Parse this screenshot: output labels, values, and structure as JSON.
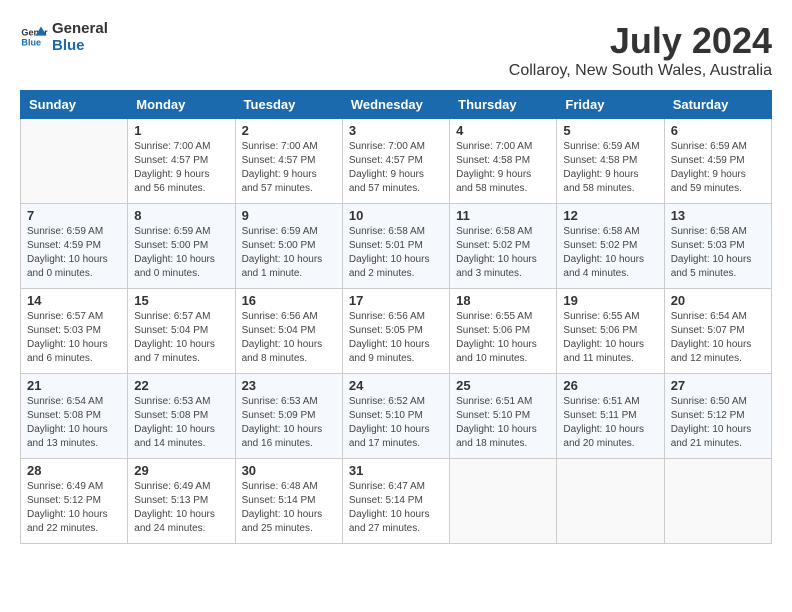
{
  "logo": {
    "line1": "General",
    "line2": "Blue"
  },
  "title": "July 2024",
  "subtitle": "Collaroy, New South Wales, Australia",
  "days_of_week": [
    "Sunday",
    "Monday",
    "Tuesday",
    "Wednesday",
    "Thursday",
    "Friday",
    "Saturday"
  ],
  "weeks": [
    [
      {
        "num": "",
        "info": ""
      },
      {
        "num": "1",
        "info": "Sunrise: 7:00 AM\nSunset: 4:57 PM\nDaylight: 9 hours\nand 56 minutes."
      },
      {
        "num": "2",
        "info": "Sunrise: 7:00 AM\nSunset: 4:57 PM\nDaylight: 9 hours\nand 57 minutes."
      },
      {
        "num": "3",
        "info": "Sunrise: 7:00 AM\nSunset: 4:57 PM\nDaylight: 9 hours\nand 57 minutes."
      },
      {
        "num": "4",
        "info": "Sunrise: 7:00 AM\nSunset: 4:58 PM\nDaylight: 9 hours\nand 58 minutes."
      },
      {
        "num": "5",
        "info": "Sunrise: 6:59 AM\nSunset: 4:58 PM\nDaylight: 9 hours\nand 58 minutes."
      },
      {
        "num": "6",
        "info": "Sunrise: 6:59 AM\nSunset: 4:59 PM\nDaylight: 9 hours\nand 59 minutes."
      }
    ],
    [
      {
        "num": "7",
        "info": "Sunrise: 6:59 AM\nSunset: 4:59 PM\nDaylight: 10 hours\nand 0 minutes."
      },
      {
        "num": "8",
        "info": "Sunrise: 6:59 AM\nSunset: 5:00 PM\nDaylight: 10 hours\nand 0 minutes."
      },
      {
        "num": "9",
        "info": "Sunrise: 6:59 AM\nSunset: 5:00 PM\nDaylight: 10 hours\nand 1 minute."
      },
      {
        "num": "10",
        "info": "Sunrise: 6:58 AM\nSunset: 5:01 PM\nDaylight: 10 hours\nand 2 minutes."
      },
      {
        "num": "11",
        "info": "Sunrise: 6:58 AM\nSunset: 5:02 PM\nDaylight: 10 hours\nand 3 minutes."
      },
      {
        "num": "12",
        "info": "Sunrise: 6:58 AM\nSunset: 5:02 PM\nDaylight: 10 hours\nand 4 minutes."
      },
      {
        "num": "13",
        "info": "Sunrise: 6:58 AM\nSunset: 5:03 PM\nDaylight: 10 hours\nand 5 minutes."
      }
    ],
    [
      {
        "num": "14",
        "info": "Sunrise: 6:57 AM\nSunset: 5:03 PM\nDaylight: 10 hours\nand 6 minutes."
      },
      {
        "num": "15",
        "info": "Sunrise: 6:57 AM\nSunset: 5:04 PM\nDaylight: 10 hours\nand 7 minutes."
      },
      {
        "num": "16",
        "info": "Sunrise: 6:56 AM\nSunset: 5:04 PM\nDaylight: 10 hours\nand 8 minutes."
      },
      {
        "num": "17",
        "info": "Sunrise: 6:56 AM\nSunset: 5:05 PM\nDaylight: 10 hours\nand 9 minutes."
      },
      {
        "num": "18",
        "info": "Sunrise: 6:55 AM\nSunset: 5:06 PM\nDaylight: 10 hours\nand 10 minutes."
      },
      {
        "num": "19",
        "info": "Sunrise: 6:55 AM\nSunset: 5:06 PM\nDaylight: 10 hours\nand 11 minutes."
      },
      {
        "num": "20",
        "info": "Sunrise: 6:54 AM\nSunset: 5:07 PM\nDaylight: 10 hours\nand 12 minutes."
      }
    ],
    [
      {
        "num": "21",
        "info": "Sunrise: 6:54 AM\nSunset: 5:08 PM\nDaylight: 10 hours\nand 13 minutes."
      },
      {
        "num": "22",
        "info": "Sunrise: 6:53 AM\nSunset: 5:08 PM\nDaylight: 10 hours\nand 14 minutes."
      },
      {
        "num": "23",
        "info": "Sunrise: 6:53 AM\nSunset: 5:09 PM\nDaylight: 10 hours\nand 16 minutes."
      },
      {
        "num": "24",
        "info": "Sunrise: 6:52 AM\nSunset: 5:10 PM\nDaylight: 10 hours\nand 17 minutes."
      },
      {
        "num": "25",
        "info": "Sunrise: 6:51 AM\nSunset: 5:10 PM\nDaylight: 10 hours\nand 18 minutes."
      },
      {
        "num": "26",
        "info": "Sunrise: 6:51 AM\nSunset: 5:11 PM\nDaylight: 10 hours\nand 20 minutes."
      },
      {
        "num": "27",
        "info": "Sunrise: 6:50 AM\nSunset: 5:12 PM\nDaylight: 10 hours\nand 21 minutes."
      }
    ],
    [
      {
        "num": "28",
        "info": "Sunrise: 6:49 AM\nSunset: 5:12 PM\nDaylight: 10 hours\nand 22 minutes."
      },
      {
        "num": "29",
        "info": "Sunrise: 6:49 AM\nSunset: 5:13 PM\nDaylight: 10 hours\nand 24 minutes."
      },
      {
        "num": "30",
        "info": "Sunrise: 6:48 AM\nSunset: 5:14 PM\nDaylight: 10 hours\nand 25 minutes."
      },
      {
        "num": "31",
        "info": "Sunrise: 6:47 AM\nSunset: 5:14 PM\nDaylight: 10 hours\nand 27 minutes."
      },
      {
        "num": "",
        "info": ""
      },
      {
        "num": "",
        "info": ""
      },
      {
        "num": "",
        "info": ""
      }
    ]
  ]
}
